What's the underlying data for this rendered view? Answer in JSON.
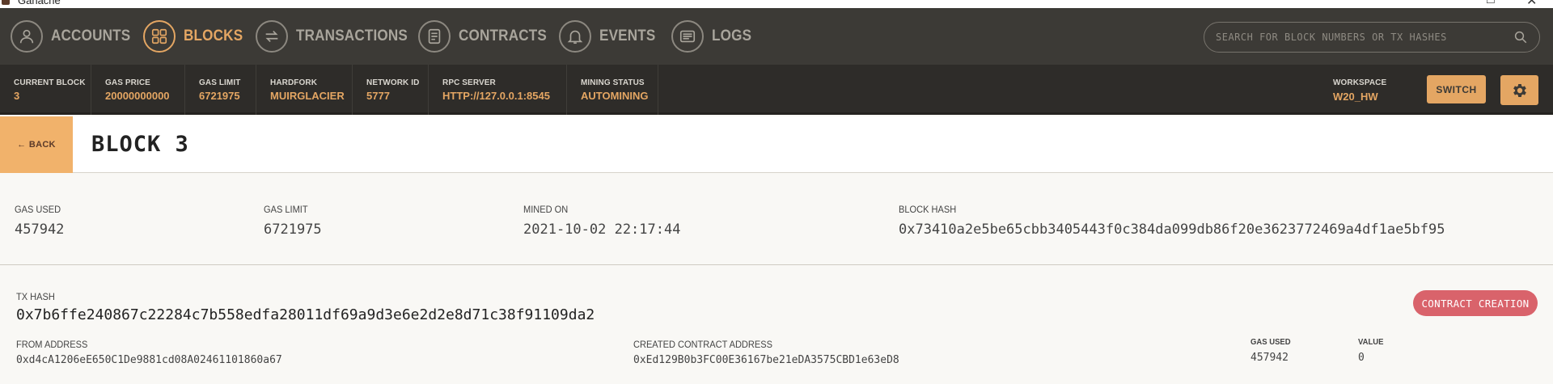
{
  "window": {
    "title": "Ganache",
    "maximize_icon": "maximize-icon",
    "close_icon": "close-icon"
  },
  "nav": {
    "items": [
      {
        "label": "ACCOUNTS",
        "icon": "person-icon"
      },
      {
        "label": "BLOCKS",
        "icon": "blocks-grid-icon",
        "active": true
      },
      {
        "label": "TRANSACTIONS",
        "icon": "swap-arrows-icon"
      },
      {
        "label": "CONTRACTS",
        "icon": "document-icon"
      },
      {
        "label": "EVENTS",
        "icon": "bell-icon"
      },
      {
        "label": "LOGS",
        "icon": "terminal-icon"
      }
    ],
    "search_placeholder": "SEARCH FOR BLOCK NUMBERS OR TX HASHES"
  },
  "status": {
    "current_block": {
      "label": "CURRENT BLOCK",
      "value": "3"
    },
    "gas_price": {
      "label": "GAS PRICE",
      "value": "20000000000"
    },
    "gas_limit": {
      "label": "GAS LIMIT",
      "value": "6721975"
    },
    "hardfork": {
      "label": "HARDFORK",
      "value": "MUIRGLACIER"
    },
    "network_id": {
      "label": "NETWORK ID",
      "value": "5777"
    },
    "rpc_server": {
      "label": "RPC SERVER",
      "value": "HTTP://127.0.0.1:8545"
    },
    "mining_status": {
      "label": "MINING STATUS",
      "value": "AUTOMINING"
    },
    "workspace": {
      "label": "WORKSPACE",
      "value": "W20_HW"
    },
    "switch_label": "SWITCH"
  },
  "block": {
    "back_label": "← BACK",
    "title": "BLOCK 3",
    "gas_used": {
      "label": "GAS USED",
      "value": "457942"
    },
    "gas_limit": {
      "label": "GAS LIMIT",
      "value": "6721975"
    },
    "mined_on": {
      "label": "MINED ON",
      "value": "2021-10-02 22:17:44"
    },
    "block_hash": {
      "label": "BLOCK HASH",
      "value": "0x73410a2e5be65cbb3405443f0c384da099db86f20e3623772469a4df1ae5bf95"
    }
  },
  "transaction": {
    "hash_label": "TX HASH",
    "hash": "0x7b6ffe240867c22284c7b558edfa28011df69a9d3e6e2d2e8d71c38f91109da2",
    "badge": "CONTRACT CREATION",
    "from_label": "FROM ADDRESS",
    "from": "0xd4cA1206eE650C1De9881cd08A02461101860a67",
    "created_label": "CREATED CONTRACT ADDRESS",
    "created": "0xEd129B0b3FC00E36167be21eDA3575CBD1e63eD8",
    "gas_used_label": "GAS USED",
    "gas_used": "457942",
    "value_label": "VALUE",
    "value": "0"
  },
  "colors": {
    "accent": "#e4a663",
    "nav_bg": "#3c3a36",
    "status_bg": "#2e2c29",
    "badge": "#d9636b"
  }
}
